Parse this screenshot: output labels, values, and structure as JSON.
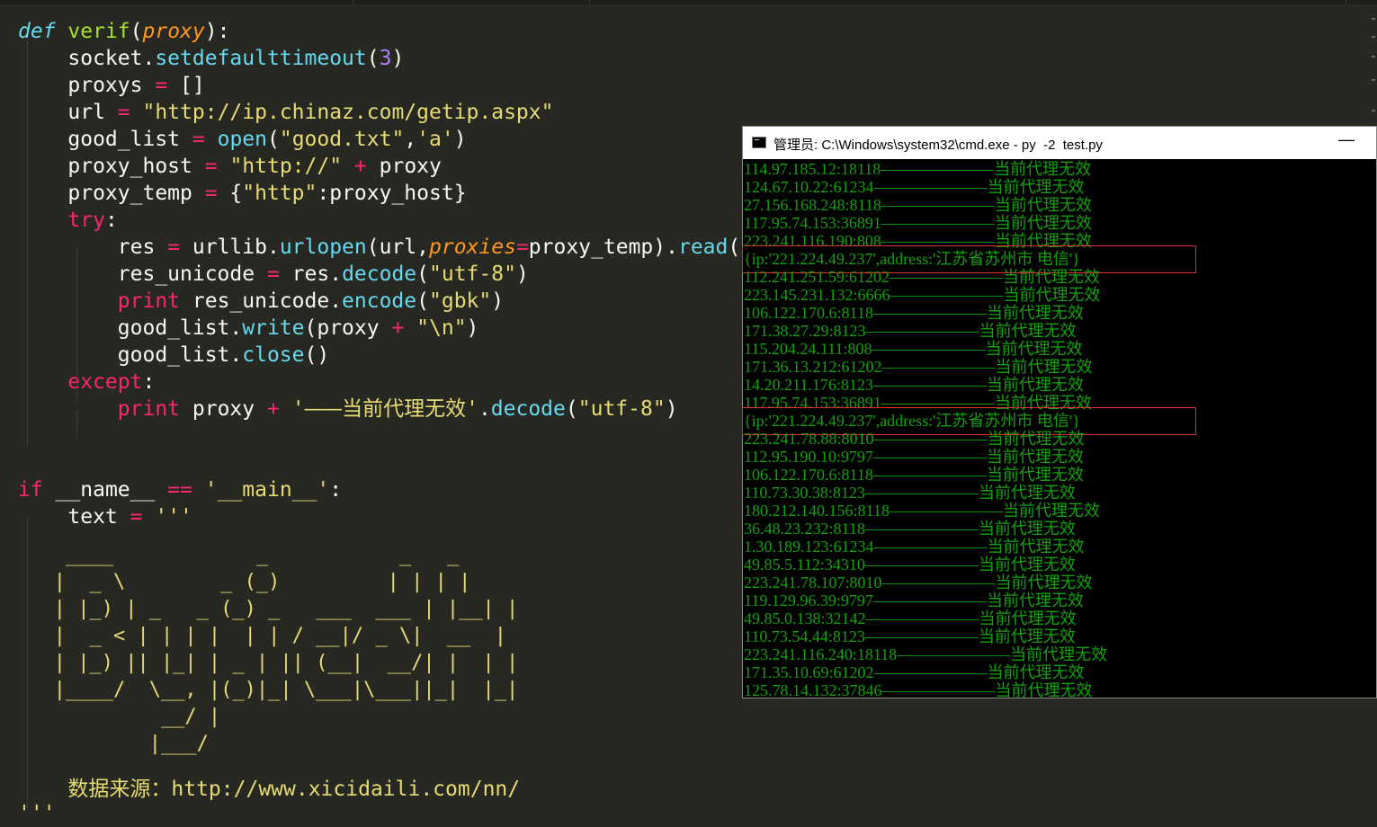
{
  "editor": {
    "lines": [
      [
        [
          "def",
          "def"
        ],
        [
          "pl",
          " "
        ],
        [
          "fn",
          "verif"
        ],
        [
          "pl",
          "("
        ],
        [
          "param",
          "proxy"
        ],
        [
          "pl",
          "):"
        ]
      ],
      [
        [
          "pl",
          "    socket."
        ],
        [
          "call",
          "setdefaulttimeout"
        ],
        [
          "pl",
          "("
        ],
        [
          "num",
          "3"
        ],
        [
          "pl",
          ")"
        ]
      ],
      [
        [
          "pl",
          "    proxys "
        ],
        [
          "op",
          "="
        ],
        [
          "pl",
          " []"
        ]
      ],
      [
        [
          "pl",
          "    url "
        ],
        [
          "op",
          "="
        ],
        [
          "pl",
          " "
        ],
        [
          "str",
          "\"http://ip.chinaz.com/getip.aspx\""
        ]
      ],
      [
        [
          "pl",
          "    good_list "
        ],
        [
          "op",
          "="
        ],
        [
          "pl",
          " "
        ],
        [
          "call",
          "open"
        ],
        [
          "pl",
          "("
        ],
        [
          "str",
          "\"good.txt\""
        ],
        [
          "pl",
          ","
        ],
        [
          "str",
          "'a'"
        ],
        [
          "pl",
          ")"
        ]
      ],
      [
        [
          "pl",
          "    proxy_host "
        ],
        [
          "op",
          "="
        ],
        [
          "pl",
          " "
        ],
        [
          "str",
          "\"http://\""
        ],
        [
          "pl",
          " "
        ],
        [
          "op",
          "+"
        ],
        [
          "pl",
          " proxy"
        ]
      ],
      [
        [
          "pl",
          "    proxy_temp "
        ],
        [
          "op",
          "="
        ],
        [
          "pl",
          " {"
        ],
        [
          "str",
          "\"http\""
        ],
        [
          "pl",
          ":proxy_host}"
        ]
      ],
      [
        [
          "pl",
          "    "
        ],
        [
          "kw",
          "try"
        ],
        [
          "pl",
          ":"
        ]
      ],
      [
        [
          "pl",
          "        res "
        ],
        [
          "op",
          "="
        ],
        [
          "pl",
          " urllib."
        ],
        [
          "call",
          "urlopen"
        ],
        [
          "pl",
          "(url,"
        ],
        [
          "param",
          "proxies"
        ],
        [
          "op",
          "="
        ],
        [
          "pl",
          "proxy_temp)."
        ],
        [
          "call",
          "read"
        ],
        [
          "pl",
          "()"
        ]
      ],
      [
        [
          "pl",
          "        res_unicode "
        ],
        [
          "op",
          "="
        ],
        [
          "pl",
          " res."
        ],
        [
          "call",
          "decode"
        ],
        [
          "pl",
          "("
        ],
        [
          "str",
          "\"utf-8\""
        ],
        [
          "pl",
          ")"
        ]
      ],
      [
        [
          "pl",
          "        "
        ],
        [
          "kw",
          "print"
        ],
        [
          "pl",
          " res_unicode."
        ],
        [
          "call",
          "encode"
        ],
        [
          "pl",
          "("
        ],
        [
          "str",
          "\"gbk\""
        ],
        [
          "pl",
          ")"
        ]
      ],
      [
        [
          "pl",
          "        good_list."
        ],
        [
          "call",
          "write"
        ],
        [
          "pl",
          "(proxy "
        ],
        [
          "op",
          "+"
        ],
        [
          "pl",
          " "
        ],
        [
          "str",
          "\"\\n\""
        ],
        [
          "pl",
          ")"
        ]
      ],
      [
        [
          "pl",
          "        good_list."
        ],
        [
          "call",
          "close"
        ],
        [
          "pl",
          "()"
        ]
      ],
      [
        [
          "pl",
          "    "
        ],
        [
          "kw",
          "except"
        ],
        [
          "pl",
          ":"
        ]
      ],
      [
        [
          "pl",
          "        "
        ],
        [
          "kw",
          "print"
        ],
        [
          "pl",
          " proxy "
        ],
        [
          "op",
          "+"
        ],
        [
          "pl",
          " "
        ],
        [
          "str",
          "'———当前代理无效'"
        ],
        [
          "pl",
          "."
        ],
        [
          "call",
          "decode"
        ],
        [
          "pl",
          "("
        ],
        [
          "str",
          "\"utf-8\""
        ],
        [
          "pl",
          ")"
        ]
      ],
      [],
      [],
      [
        [
          "kw",
          "if"
        ],
        [
          "pl",
          " __name__ "
        ],
        [
          "op",
          "=="
        ],
        [
          "pl",
          " "
        ],
        [
          "str",
          "'__main__'"
        ],
        [
          "pl",
          ":"
        ]
      ],
      [
        [
          "pl",
          "    text "
        ],
        [
          "op",
          "="
        ],
        [
          "pl",
          " "
        ],
        [
          "str",
          "'''"
        ]
      ]
    ],
    "ascii_art": "    ____            _           _   _ \n   |  _ \\        _ (_)         | | | |\n   | |_) | _   _ (_) _   ___  ___ | |__| |\n   |  _ < | | | |  | | / __|/ _ \\|  __  |\n   | |_) || |_| | _ | || (__|  __/| |  | |\n   |____/  \\__, |(_)|_| \\___|\\___||_|  |_|\n            __/ |\n           |___/",
    "source_line": "    数据来源：http://www.xicidaili.com/nn/",
    "closing_quote": "'''"
  },
  "cmd": {
    "title": "管理员: C:\\Windows\\system32\\cmd.exe - py  -2  test.py",
    "minimize": "—",
    "lines": [
      "114.97.185.12:18118———————当前代理无效",
      "124.67.10.22:61234———————当前代理无效",
      "27.156.168.248:8118———————当前代理无效",
      "117.95.74.153:36891———————当前代理无效",
      "223.241.116.190:808———————当前代理无效",
      "{ip:'221.224.49.237',address:'江苏省苏州市 电信'}",
      "112.241.251.59:61202———————当前代理无效",
      "223.145.231.132:6666———————当前代理无效",
      "106.122.170.6:8118———————当前代理无效",
      "171.38.27.29:8123———————当前代理无效",
      "115.204.24.111:808———————当前代理无效",
      "171.36.13.212:61202———————当前代理无效",
      "14.20.211.176:8123———————当前代理无效",
      "117.95.74.153:36891———————当前代理无效",
      "{ip:'221.224.49.237',address:'江苏省苏州市 电信'}",
      "223.241.78.88:8010———————当前代理无效",
      "112.95.190.10:9797———————当前代理无效",
      "106.122.170.6:8118———————当前代理无效",
      "110.73.30.38:8123———————当前代理无效",
      "180.212.140.156:8118———————当前代理无效",
      "36.48.23.232:8118———————当前代理无效",
      "1.30.189.123:61234———————当前代理无效",
      "49.85.5.112:34310———————当前代理无效",
      "223.241.78.107:8010———————当前代理无效",
      "119.129.96.39:9797———————当前代理无效",
      "49.85.0.138:32142———————当前代理无效",
      "110.73.54.44:8123———————当前代理无效",
      "223.241.116.240:18118———————当前代理无效",
      "171.35.10.69:61202———————当前代理无效",
      "125.78.14.132:37846———————当前代理无效"
    ],
    "highlighted_lines": [
      5,
      14
    ]
  },
  "colors": {
    "editor_bg": "#272822",
    "keyword": "#f92672",
    "string": "#e6db74",
    "builtin": "#66d9ef",
    "function_name": "#a6e22e",
    "parameter": "#fd971f",
    "number": "#ae81ff",
    "cmd_text": "#13a10e",
    "highlight_box": "#e0302b"
  }
}
